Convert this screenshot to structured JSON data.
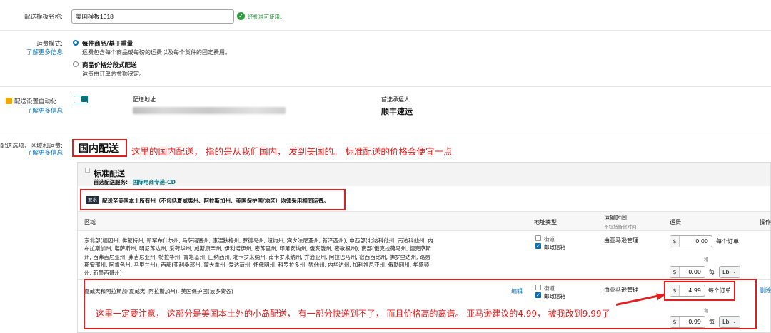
{
  "template": {
    "label": "配送模板名称:",
    "name": "美国模板1018",
    "valid_text": "经批准可使用。"
  },
  "fee_mode": {
    "label": "运费模式:",
    "learn_more": "了解更多信息",
    "options": [
      {
        "title": "每件商品/基于重量",
        "desc": "运费包含每个商品或每磅的运费以及每个货件的固定费用。",
        "selected": true
      },
      {
        "title": "商品价格分段式配送",
        "desc": "运费由订单总金额决定。",
        "selected": false
      }
    ]
  },
  "automation": {
    "label": "配送设置自动化",
    "learn_more": "了解更多信息",
    "address_label": "配送地址",
    "carrier_label": "首选承运人",
    "carrier_value": "顺丰速运"
  },
  "options_section": {
    "label": "配送选项、区域和运费:",
    "learn_more": "了解更多信息",
    "domestic_title": "国内配送",
    "domestic_note": "这里的国内配送， 指的是从我们国内， 发到美国的。 标准配送的价格会便宜一点"
  },
  "standard": {
    "title": "标准配送",
    "service_label": "首选配送服务:",
    "service_value": "国际电商专递-CD",
    "req_badge": "要求",
    "req_text": "配送至美国本土所有州（不包括夏威夷州、阿拉斯加州、美国保护国/地区）均须采用相同运费。"
  },
  "table": {
    "headers": {
      "region": "区域",
      "address_type": "地址类型",
      "transit": "运输时间",
      "transit_sub": "不包括备货时间",
      "fee": "运费",
      "action": "操作"
    },
    "rows": [
      {
        "region": "东北部(缅因州, 佛蒙特州, 新罕布什尔州, 马萨诸塞州, 康涅狄格州, 罗德岛州, 纽约州, 宾夕法尼亚州, 新泽西州), 中西部(北达科他州, 南达科他州, 内布拉斯加州, 堪萨斯州, 明尼苏达州, 爱荷华州, 威斯康辛州, 伊利诺伊州, 密苏里州, 印第安纳州, 俄亥俄州, 密歇根州), 南部(俄克拉荷马州, 德克萨斯州, 西弗吉尼亚州, 弗吉尼亚州, 特拉华州, 肯塔基州, 田纳西州, 北卡罗来纳州, 南卡罗来纳州, 乔治亚州, 阿拉巴马州, 密西西比州, 佛罗里达州, 路易斯安那州, 阿肯色州, 马里兰州), 西部(亚利桑那州, 蒙大拿州, 爱达荷州, 怀俄明州, 科罗拉多州, 犹他州, 内华达州, 加利福尼亚州, 俄勒冈州, 华盛顿州, 新墨西哥州)",
        "addr_street": "街道",
        "addr_po": "邮政信箱",
        "transit": "由亚马逊管理",
        "fee_order": "0.00",
        "fee_order_unit": "每个订单",
        "fee_sep": "和",
        "fee_item": "0.00",
        "fee_item_unit": "每",
        "fee_item_select": "Lb"
      },
      {
        "region": "夏威夷和阿拉斯加(夏威夷, 阿拉斯加州), 美国保护国(波多黎各)",
        "edit": "编辑",
        "addr_street": "街道",
        "addr_po": "邮政信箱",
        "transit": "由亚马逊管理",
        "fee_order": "4.99",
        "fee_order_unit": "每个订单",
        "fee_sep": "和",
        "fee_item": "0.99",
        "fee_item_unit": "每",
        "fee_item_select": "Lb",
        "action": "删除"
      }
    ],
    "currency": "$"
  },
  "island_note": "这里一定要注意， 这部分是美国本土外的小岛配送， 有一部分快递到不了， 而且价格高的离谱。 亚马逊建议的4.99， 被我改到9.99了",
  "colors": {
    "accent": "#0a6fb5",
    "annotation": "#e02020",
    "ok": "#2f9a41"
  }
}
